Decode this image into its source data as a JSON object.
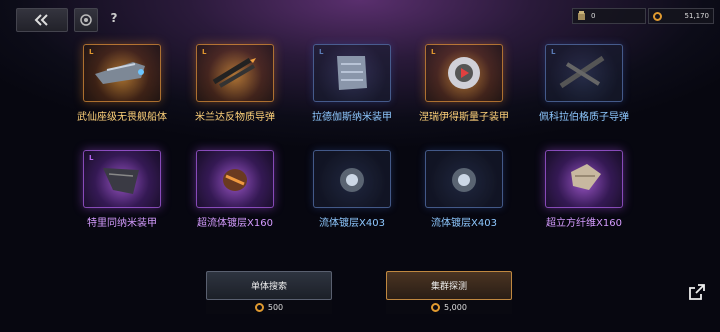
{
  "header": {
    "help_label": "?",
    "resources": {
      "currency_a": "0",
      "currency_b": "51,170"
    }
  },
  "items": [
    {
      "grade": "L",
      "label": "武仙座级无畏舰船体",
      "tier": "orange",
      "label_color": "#ffd27a",
      "icon": "ship-hull-icon"
    },
    {
      "grade": "L",
      "label": "米兰达反物质导弹",
      "tier": "orange",
      "label_color": "#ffd27a",
      "icon": "missile-icon"
    },
    {
      "grade": "L",
      "label": "拉德伽斯纳米装甲",
      "tier": "blue",
      "label_color": "#8ec8ff",
      "icon": "armor-plate-icon"
    },
    {
      "grade": "L",
      "label": "涅瑞伊得斯量子装甲",
      "tier": "orange",
      "label_color": "#ffd27a",
      "icon": "shield-emblem-icon"
    },
    {
      "grade": "L",
      "label": "佩科拉伯格质子导弹",
      "tier": "blue",
      "label_color": "#8ec8ff",
      "icon": "proton-missile-icon"
    },
    {
      "grade": "L",
      "label": "特里同纳米装甲",
      "tier": "purple",
      "label_color": "#d59cff",
      "icon": "armor-panel-icon"
    },
    {
      "grade": "",
      "label": "超流体镀层X160",
      "tier": "purple",
      "label_color": "#d59cff",
      "icon": "orange-canister-icon"
    },
    {
      "grade": "",
      "label": "流体镀层X403",
      "tier": "blue",
      "label_color": "#8ec8ff",
      "icon": "silver-canister-icon"
    },
    {
      "grade": "",
      "label": "流体镀层X403",
      "tier": "blue",
      "label_color": "#8ec8ff",
      "icon": "silver-canister-icon"
    },
    {
      "grade": "",
      "label": "超立方纤维X160",
      "tier": "purple",
      "label_color": "#d59cff",
      "icon": "fiber-cube-icon"
    }
  ],
  "actions": {
    "single": {
      "label": "单体搜索",
      "cost": "500"
    },
    "cluster": {
      "label": "集群探测",
      "cost": "5,000"
    }
  },
  "colors": {
    "orange": "#e0962f",
    "blue": "#5a7ab4",
    "purple": "#b464f0"
  }
}
